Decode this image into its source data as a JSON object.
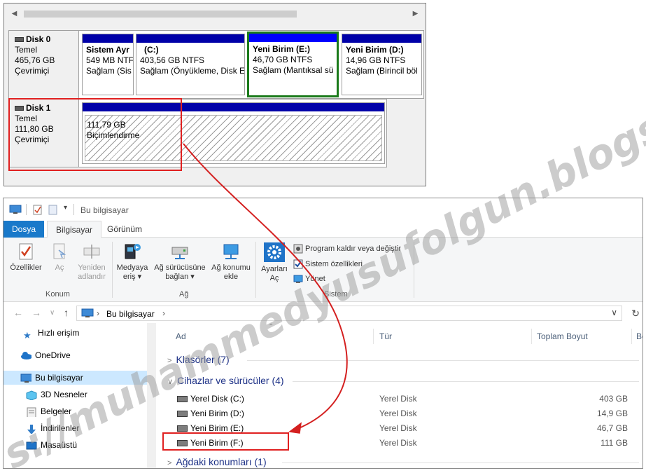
{
  "disk_management": {
    "disks": [
      {
        "name": "Disk 0",
        "type": "Temel",
        "size": "465,76 GB",
        "status": "Çevrimiçi",
        "partitions": [
          {
            "name": "Sistem Ayr",
            "size": "549 MB NTF",
            "status": "Sağlam (Sis"
          },
          {
            "name": "(C:)",
            "size": "403,56 GB NTFS",
            "status": "Sağlam (Önyükleme, Disk E"
          },
          {
            "name": "Yeni Birim  (E:)",
            "size": "46,70 GB NTFS",
            "status": "Sağlam (Mantıksal sü"
          },
          {
            "name": "Yeni Birim  (D:)",
            "size": "14,96 GB NTFS",
            "status": "Sağlam (Birincil böl"
          }
        ]
      },
      {
        "name": "Disk 1",
        "type": "Temel",
        "size": "111,80 GB",
        "status": "Çevrimiçi",
        "partitions": [
          {
            "size": "111,79 GB",
            "status": "Biçimlendirme"
          }
        ]
      }
    ]
  },
  "explorer": {
    "title": "Bu bilgisayar",
    "tabs": [
      "Dosya",
      "Bilgisayar",
      "Görünüm"
    ],
    "ribbon": {
      "konum": {
        "label": "Konum",
        "buttons": [
          {
            "line1": "Özellikler",
            "line2": ""
          },
          {
            "line1": "Aç",
            "line2": ""
          },
          {
            "line1": "Yeniden",
            "line2": "adlandır"
          }
        ]
      },
      "ag": {
        "label": "Ağ",
        "buttons": [
          {
            "line1": "Medyaya",
            "line2": "eriş ▾"
          },
          {
            "line1": "Ağ sürücüsüne",
            "line2": "bağlan ▾"
          },
          {
            "line1": "Ağ konumu",
            "line2": "ekle"
          }
        ]
      },
      "sistem": {
        "label": "Sistem",
        "big_button": {
          "line1": "Ayarları",
          "line2": "Aç"
        },
        "small_buttons": [
          "Program kaldır veya değiştir",
          "Sistem özellikleri",
          "Yönet"
        ]
      }
    },
    "address": {
      "path": "Bu bilgisayar",
      "separator": "›"
    },
    "nav": [
      {
        "label": "Hızlı erişim",
        "icon": "star-icon"
      },
      {
        "label": "OneDrive",
        "icon": "cloud-icon"
      },
      {
        "label": "Bu bilgisayar",
        "icon": "computer-icon"
      },
      {
        "label": "3D Nesneler",
        "icon": "cube-icon"
      },
      {
        "label": "Belgeler",
        "icon": "document-icon"
      },
      {
        "label": "İndirilenler",
        "icon": "download-icon"
      },
      {
        "label": "Masaüstü",
        "icon": "desktop-icon"
      }
    ],
    "columns": [
      "Ad",
      "Tür",
      "Toplam Boyut",
      "Bo"
    ],
    "groups": {
      "folders": "Klasörler (7)",
      "devices": "Cihazlar ve sürücüler (4)",
      "network": "Ağdaki konumları (1)"
    },
    "drives": [
      {
        "name": "Yerel Disk (C:)",
        "type": "Yerel Disk",
        "size": "403 GB"
      },
      {
        "name": "Yeni Birim (D:)",
        "type": "Yerel Disk",
        "size": "14,9 GB"
      },
      {
        "name": "Yeni Birim (E:)",
        "type": "Yerel Disk",
        "size": "46,7 GB"
      },
      {
        "name": "Yeni Birim (F:)",
        "type": "Yerel Disk",
        "size": "111 GB"
      }
    ]
  },
  "watermark": "s://muhammedyusufolgun.blogspot",
  "colors": {
    "highlight_red": "#e02020",
    "selected_green": "#1a7a1a",
    "partition_bar": "#0000a8",
    "file_tab": "#1979ca"
  }
}
